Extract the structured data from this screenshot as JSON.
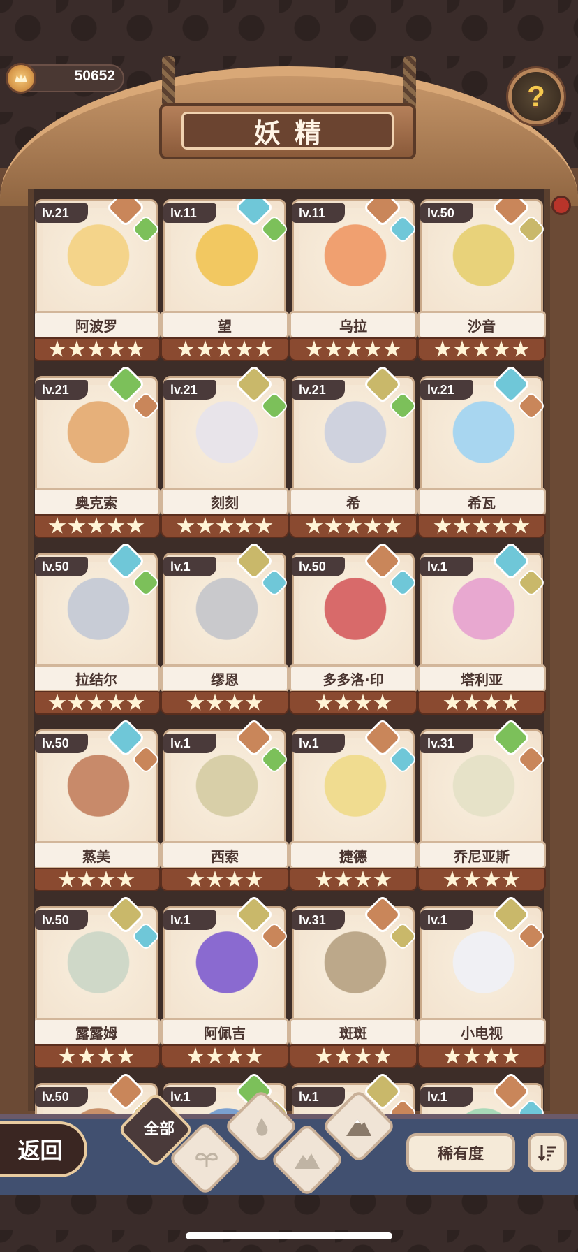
{
  "header": {
    "currency_value": "50652",
    "title": "妖精",
    "help_label": "?"
  },
  "elements": {
    "fire": "#c9865a",
    "water": "#6fc7d8",
    "grass": "#7cc05a",
    "earth": "#c9b86a"
  },
  "fairies": [
    {
      "level": "lv.21",
      "name": "阿波罗",
      "stars": 5,
      "el1": "fire",
      "el2": "grass",
      "color": "#f4d48a"
    },
    {
      "level": "lv.11",
      "name": "望",
      "stars": 5,
      "el1": "water",
      "el2": "grass",
      "color": "#f2c861"
    },
    {
      "level": "lv.11",
      "name": "乌拉",
      "stars": 5,
      "el1": "fire",
      "el2": "water",
      "color": "#f0a070"
    },
    {
      "level": "lv.50",
      "name": "沙音",
      "stars": 5,
      "el1": "fire",
      "el2": "earth",
      "color": "#e8d27a"
    },
    {
      "level": "lv.21",
      "name": "奥克索",
      "stars": 5,
      "el1": "grass",
      "el2": "fire",
      "color": "#e6b07a"
    },
    {
      "level": "lv.21",
      "name": "刻刻",
      "stars": 5,
      "el1": "earth",
      "el2": "grass",
      "color": "#e8e4ea"
    },
    {
      "level": "lv.21",
      "name": "希",
      "stars": 5,
      "el1": "earth",
      "el2": "grass",
      "color": "#cfd2de"
    },
    {
      "level": "lv.21",
      "name": "希瓦",
      "stars": 5,
      "el1": "water",
      "el2": "fire",
      "color": "#a8d6f0"
    },
    {
      "level": "lv.50",
      "name": "拉结尔",
      "stars": 5,
      "el1": "water",
      "el2": "grass",
      "color": "#c8ccd6"
    },
    {
      "level": "lv.1",
      "name": "缪恩",
      "stars": 4,
      "el1": "earth",
      "el2": "water",
      "color": "#c9c9cc"
    },
    {
      "level": "lv.50",
      "name": "多多洛·印",
      "stars": 4,
      "el1": "fire",
      "el2": "water",
      "color": "#d86a6a"
    },
    {
      "level": "lv.1",
      "name": "塔利亚",
      "stars": 4,
      "el1": "water",
      "el2": "earth",
      "color": "#e8a8d0"
    },
    {
      "level": "lv.50",
      "name": "蒸美",
      "stars": 4,
      "el1": "water",
      "el2": "fire",
      "color": "#c88a6a"
    },
    {
      "level": "lv.1",
      "name": "西索",
      "stars": 4,
      "el1": "fire",
      "el2": "grass",
      "color": "#d8cfa8"
    },
    {
      "level": "lv.1",
      "name": "捷德",
      "stars": 4,
      "el1": "fire",
      "el2": "water",
      "color": "#f0dc90"
    },
    {
      "level": "lv.31",
      "name": "乔尼亚斯",
      "stars": 4,
      "el1": "grass",
      "el2": "fire",
      "color": "#e6e2c8"
    },
    {
      "level": "lv.50",
      "name": "露露姆",
      "stars": 4,
      "el1": "earth",
      "el2": "water",
      "color": "#cfd8c8"
    },
    {
      "level": "lv.1",
      "name": "阿佩吉",
      "stars": 4,
      "el1": "earth",
      "el2": "fire",
      "color": "#8a6ad0"
    },
    {
      "level": "lv.31",
      "name": "斑斑",
      "stars": 4,
      "el1": "fire",
      "el2": "earth",
      "color": "#bca88a"
    },
    {
      "level": "lv.1",
      "name": "小电视",
      "stars": 4,
      "el1": "earth",
      "el2": "fire",
      "color": "#f0f0f4"
    },
    {
      "level": "lv.50",
      "name": "",
      "stars": 0,
      "el1": "fire",
      "el2": "earth",
      "color": "#c8906a"
    },
    {
      "level": "lv.1",
      "name": "",
      "stars": 0,
      "el1": "grass",
      "el2": "earth",
      "color": "#7aa0d0"
    },
    {
      "level": "lv.1",
      "name": "",
      "stars": 0,
      "el1": "earth",
      "el2": "fire",
      "color": "#d0b070"
    },
    {
      "level": "lv.1",
      "name": "",
      "stars": 0,
      "el1": "fire",
      "el2": "water",
      "color": "#a8d8b8"
    }
  ],
  "bottom": {
    "back_label": "返回",
    "filter_all_label": "全部",
    "filters": [
      "all-filter",
      "grass-filter",
      "water-filter",
      "earth-filter",
      "fire-filter"
    ],
    "rarity_label": "稀有度",
    "sort_icon": "sort-icon"
  }
}
